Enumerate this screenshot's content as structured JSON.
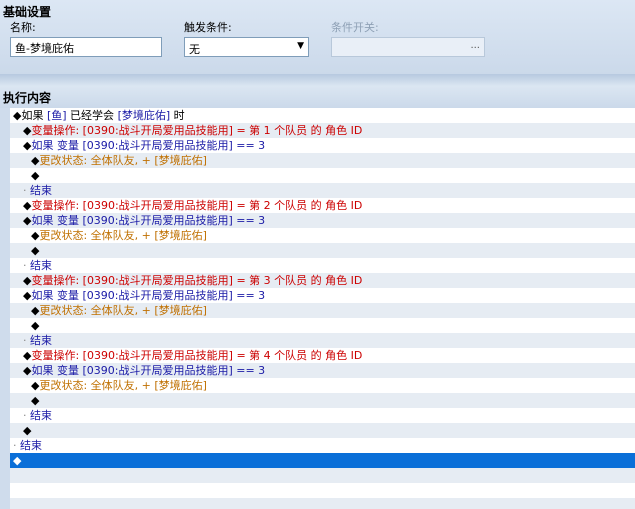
{
  "basic": {
    "title": "基础设置",
    "name_label": "名称:",
    "name_value": "鱼-梦境庇佑",
    "trigger_label": "触发条件:",
    "trigger_value": "无",
    "switch_label": "条件开关:",
    "switch_button": "..."
  },
  "exec": {
    "title": "执行内容"
  },
  "rows": [
    {
      "indent": 3,
      "alt": false,
      "parts": [
        [
          "black",
          "◆如果 "
        ],
        [
          "blue",
          "[鱼]"
        ],
        [
          "black",
          " 已经学会 "
        ],
        [
          "blue",
          "[梦境庇佑]"
        ],
        [
          "black",
          " 时"
        ]
      ]
    },
    {
      "indent": 13,
      "alt": true,
      "parts": [
        [
          "black",
          "◆"
        ],
        [
          "red",
          "变量操作: [0390:战斗开局爱用品技能用] = 第 1 个队员 的 角色 ID"
        ]
      ]
    },
    {
      "indent": 13,
      "alt": false,
      "parts": [
        [
          "black",
          "◆"
        ],
        [
          "blue",
          "如果 变量 [0390:战斗开局爱用品技能用] == 3"
        ]
      ]
    },
    {
      "indent": 21,
      "alt": true,
      "parts": [
        [
          "black",
          "◆"
        ],
        [
          "orange",
          "更改状态: 全体队友, + [梦境庇佑]"
        ]
      ]
    },
    {
      "indent": 21,
      "alt": false,
      "parts": [
        [
          "black",
          "◆"
        ]
      ]
    },
    {
      "indent": 13,
      "alt": true,
      "parts": [
        [
          "gray",
          "· "
        ],
        [
          "blue",
          "结束"
        ]
      ]
    },
    {
      "indent": 13,
      "alt": false,
      "parts": [
        [
          "black",
          "◆"
        ],
        [
          "red",
          "变量操作: [0390:战斗开局爱用品技能用] = 第 2 个队员 的 角色 ID"
        ]
      ]
    },
    {
      "indent": 13,
      "alt": true,
      "parts": [
        [
          "black",
          "◆"
        ],
        [
          "blue",
          "如果 变量 [0390:战斗开局爱用品技能用] == 3"
        ]
      ]
    },
    {
      "indent": 21,
      "alt": false,
      "parts": [
        [
          "black",
          "◆"
        ],
        [
          "orange",
          "更改状态: 全体队友, + [梦境庇佑]"
        ]
      ]
    },
    {
      "indent": 21,
      "alt": true,
      "parts": [
        [
          "black",
          "◆"
        ]
      ]
    },
    {
      "indent": 13,
      "alt": false,
      "parts": [
        [
          "gray",
          "· "
        ],
        [
          "blue",
          "结束"
        ]
      ]
    },
    {
      "indent": 13,
      "alt": true,
      "parts": [
        [
          "black",
          "◆"
        ],
        [
          "red",
          "变量操作: [0390:战斗开局爱用品技能用] = 第 3 个队员 的 角色 ID"
        ]
      ]
    },
    {
      "indent": 13,
      "alt": false,
      "parts": [
        [
          "black",
          "◆"
        ],
        [
          "blue",
          "如果 变量 [0390:战斗开局爱用品技能用] == 3"
        ]
      ]
    },
    {
      "indent": 21,
      "alt": true,
      "parts": [
        [
          "black",
          "◆"
        ],
        [
          "orange",
          "更改状态: 全体队友, + [梦境庇佑]"
        ]
      ]
    },
    {
      "indent": 21,
      "alt": false,
      "parts": [
        [
          "black",
          "◆"
        ]
      ]
    },
    {
      "indent": 13,
      "alt": true,
      "parts": [
        [
          "gray",
          "· "
        ],
        [
          "blue",
          "结束"
        ]
      ]
    },
    {
      "indent": 13,
      "alt": false,
      "parts": [
        [
          "black",
          "◆"
        ],
        [
          "red",
          "变量操作: [0390:战斗开局爱用品技能用] = 第 4 个队员 的 角色 ID"
        ]
      ]
    },
    {
      "indent": 13,
      "alt": true,
      "parts": [
        [
          "black",
          "◆"
        ],
        [
          "blue",
          "如果 变量 [0390:战斗开局爱用品技能用] == 3"
        ]
      ]
    },
    {
      "indent": 21,
      "alt": false,
      "parts": [
        [
          "black",
          "◆"
        ],
        [
          "orange",
          "更改状态: 全体队友, + [梦境庇佑]"
        ]
      ]
    },
    {
      "indent": 21,
      "alt": true,
      "parts": [
        [
          "black",
          "◆"
        ]
      ]
    },
    {
      "indent": 13,
      "alt": false,
      "parts": [
        [
          "gray",
          "· "
        ],
        [
          "blue",
          "结束"
        ]
      ]
    },
    {
      "indent": 13,
      "alt": true,
      "parts": [
        [
          "black",
          "◆"
        ]
      ]
    },
    {
      "indent": 3,
      "alt": false,
      "parts": [
        [
          "gray",
          "· "
        ],
        [
          "blue",
          "结束"
        ]
      ]
    },
    {
      "indent": 3,
      "alt": false,
      "selected": true,
      "parts": [
        [
          "white",
          "◆"
        ]
      ]
    },
    {
      "indent": 3,
      "alt": true,
      "parts": []
    },
    {
      "indent": 3,
      "alt": false,
      "parts": []
    },
    {
      "indent": 3,
      "alt": true,
      "parts": []
    }
  ]
}
